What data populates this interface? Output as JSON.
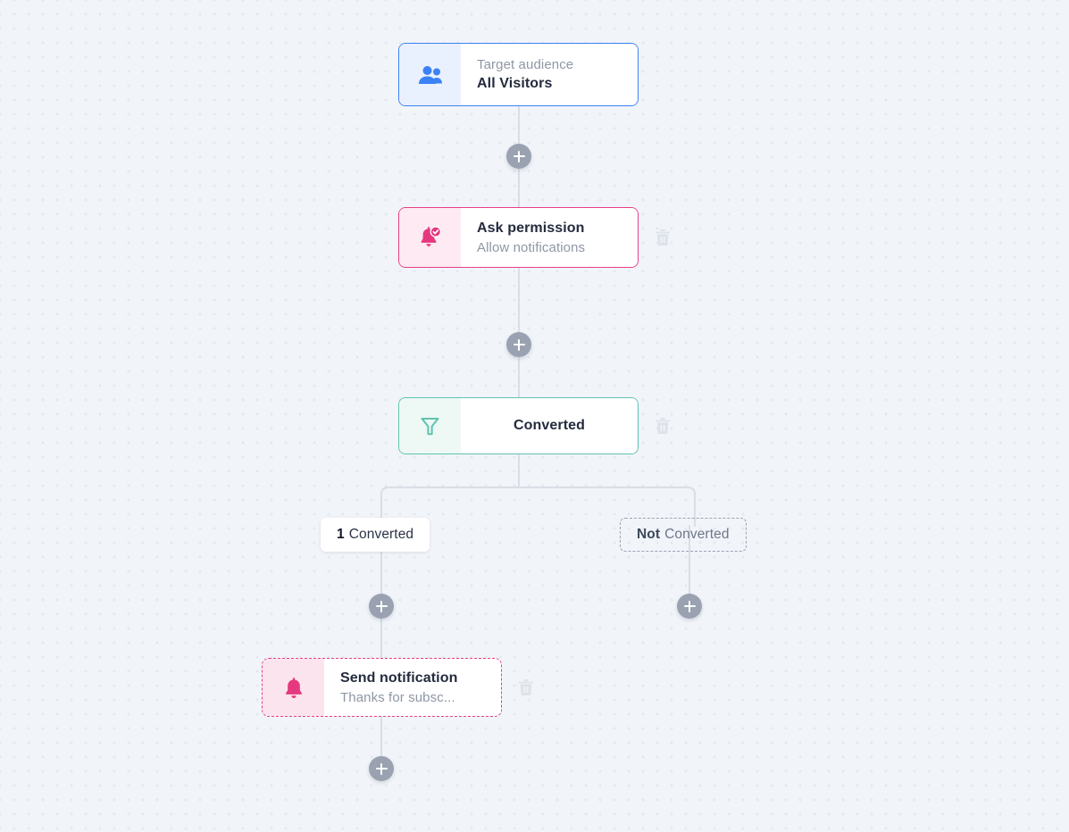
{
  "canvas": {
    "background_color": "#f1f4f9",
    "dot_color": "#e3e8ef"
  },
  "colors": {
    "audience_accent": "#3b82f6",
    "permission_accent": "#e83f86",
    "filter_accent": "#5fc3ae",
    "send_accent": "#e83f86",
    "connector": "#d9dee6",
    "plus_button": "#9aa2b1",
    "trash": "#dde2e9"
  },
  "nodes": {
    "audience": {
      "icon": "people-icon",
      "sub_label": "Target audience",
      "title": "All Visitors"
    },
    "permission": {
      "icon": "bell-check-icon",
      "title": "Ask permission",
      "sub_label": "Allow notifications",
      "delete_icon": "trash-icon"
    },
    "filter": {
      "icon": "funnel-icon",
      "title": "Converted",
      "delete_icon": "trash-icon"
    },
    "send": {
      "icon": "bell-icon",
      "title": "Send notification",
      "sub_label": "Thanks for subsc...",
      "delete_icon": "trash-icon"
    }
  },
  "branches": {
    "converted": {
      "count": "1",
      "label": "Converted"
    },
    "not_converted": {
      "prefix": "Not",
      "label": "Converted"
    }
  },
  "add_buttons": [
    {
      "id": "add-after-audience",
      "icon": "plus-icon"
    },
    {
      "id": "add-after-permission",
      "icon": "plus-icon"
    },
    {
      "id": "add-converted-branch",
      "icon": "plus-icon"
    },
    {
      "id": "add-not-converted-branch",
      "icon": "plus-icon"
    },
    {
      "id": "add-after-send",
      "icon": "plus-icon"
    }
  ]
}
